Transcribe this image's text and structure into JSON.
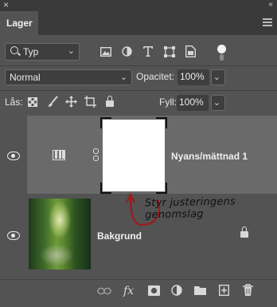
{
  "window": {
    "close_glyph": "×",
    "collapse_glyph": "‹‹"
  },
  "panel": {
    "tab_label": "Lager",
    "menu_icon": "hamburger-icon"
  },
  "filter": {
    "kind_label": "Typ",
    "kind_chevron": "⌄",
    "icons": [
      "image-filter-icon",
      "adjustment-filter-icon",
      "type-filter-icon",
      "shape-filter-icon",
      "smart-object-filter-icon"
    ],
    "toggle_on": true
  },
  "blending": {
    "mode_value": "Normal",
    "opacity_label": "Opacitet:",
    "opacity_value": "100%",
    "chevron": "⌄"
  },
  "locks": {
    "label": "Lås:",
    "fill_label": "Fyll:",
    "fill_value": "100%",
    "icons": [
      "lock-transparent-pixels-icon",
      "lock-image-pixels-icon",
      "lock-position-icon",
      "lock-artboard-icon",
      "lock-all-icon"
    ]
  },
  "layers": [
    {
      "name": "Nyans/mättnad 1",
      "visible": true,
      "type": "adjustment",
      "selected": true
    },
    {
      "name": "Bakgrund",
      "visible": true,
      "type": "background",
      "locked": true
    }
  ],
  "annotation": {
    "text": "Styr justeringens genomslag",
    "color": "#9b1b1b"
  },
  "bottom_bar": {
    "icons": [
      "link-layers-icon",
      "fx-icon",
      "add-mask-icon",
      "new-adjustment-icon",
      "new-group-icon",
      "new-layer-icon",
      "delete-layer-icon"
    ],
    "fx_label": "fx"
  }
}
